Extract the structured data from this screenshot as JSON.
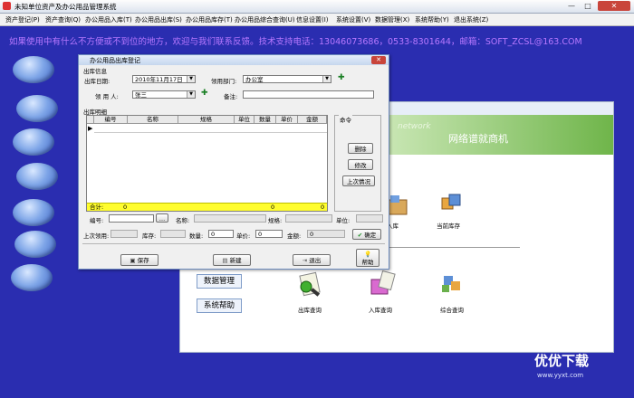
{
  "window": {
    "title": "未知单位资产及办公用品管理系统"
  },
  "menu": [
    "资产登记(P)",
    "资产查询(Q)",
    "办公用品入库(T)",
    "办公用品出库(S)",
    "办公用品库存(T)",
    "办公用品综合查询(U)",
    "信息设置(I)",
    "系统设置(V)",
    "数据管理(X)",
    "系统帮助(Y)",
    "退出系统(Z)"
  ],
  "banner": "如果使用中有什么不方便或不到位的地方，欢迎与我们联系反馈。技术支持电话：13046073686，0533-8301644，邮箱：SOFT_ZCSL@163.COM",
  "bg": {
    "header_en": "network",
    "header_cn": "网络谱就商机",
    "buttons": [
      "数据管理",
      "系统帮助"
    ],
    "icons": [
      "入库",
      "当前库存",
      "出库查询",
      "入库查询",
      "综合查询"
    ]
  },
  "dialog": {
    "title": "办公用品出库登记",
    "section_out": "出库信息",
    "date_label": "出库日期:",
    "date_value": "2010年11月17日",
    "dept_label": "领用部门:",
    "dept_value": "办公室",
    "user_label": "领 用 人:",
    "user_value": "张三",
    "note_label": "备注:",
    "section_detail": "出库明细",
    "columns": [
      "编号",
      "名称",
      "规格",
      "单位",
      "数量",
      "单价",
      "金额"
    ],
    "total_label": "合计:",
    "total_left": "0",
    "total_qty": "0",
    "total_amt": "0",
    "cmd_label": "命令",
    "cmd_buttons": [
      "删除",
      "修改",
      "上次情况"
    ],
    "f_code": "编号:",
    "f_name": "名称:",
    "f_spec": "规格:",
    "f_unit": "单位:",
    "f_last": "上次领用:",
    "f_stock": "库存:",
    "f_qty": "数量:",
    "f_qty_val": "0",
    "f_price": "单价:",
    "f_price_val": "0",
    "f_amount": "金额:",
    "f_amount_val": "0",
    "ok_label": "确定",
    "bottom": [
      "保存",
      "新建",
      "退出",
      "帮助"
    ]
  },
  "watermark": {
    "cn": "优优下载",
    "url": "www.yyxt.com"
  }
}
